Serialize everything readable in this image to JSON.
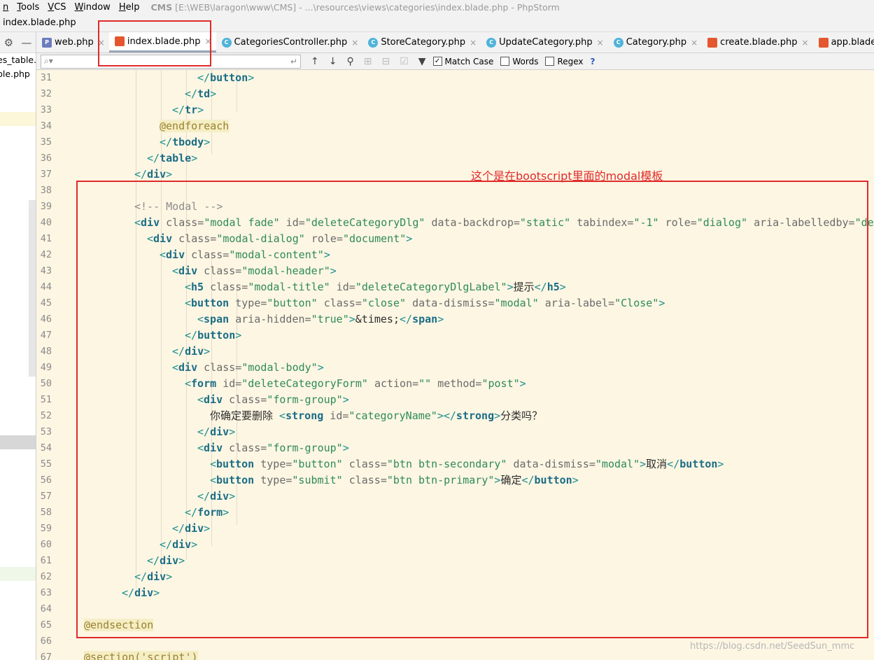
{
  "menubar": {
    "items": [
      "n",
      "Tools",
      "VCS",
      "Window",
      "Help"
    ],
    "title_app": "CMS",
    "title_path": "[E:\\WEB\\laragon\\www\\CMS] - ...\\resources\\views\\categories\\index.blade.php - PhpStorm"
  },
  "navbar": {
    "breadcrumb": "index.blade.php"
  },
  "left_panel": {
    "files": [
      "es_table.",
      "ble.php"
    ]
  },
  "tabs": [
    {
      "label": "web.php",
      "icon": "php-file-icon",
      "close": "×"
    },
    {
      "label": "index.blade.php",
      "icon": "blade-file-icon",
      "close": "×"
    },
    {
      "label": "CategoriesController.php",
      "icon": "class-file-icon",
      "close": "×"
    },
    {
      "label": "StoreCategory.php",
      "icon": "class-file-icon",
      "close": "×"
    },
    {
      "label": "UpdateCategory.php",
      "icon": "class-file-icon",
      "close": "×"
    },
    {
      "label": "Category.php",
      "icon": "class-file-icon",
      "close": "×"
    },
    {
      "label": "create.blade.php",
      "icon": "blade-file-icon",
      "close": "×"
    },
    {
      "label": "app.blade.php",
      "icon": "blade-file-icon",
      "close": "×"
    }
  ],
  "search": {
    "placeholder": "",
    "match_case_label": "Match Case",
    "match_case_checked": true,
    "words_label": "Words",
    "words_checked": false,
    "regex_label": "Regex",
    "regex_checked": false,
    "help_label": "?"
  },
  "line_numbers": [
    "31",
    "32",
    "33",
    "34",
    "35",
    "36",
    "37",
    "38",
    "39",
    "40",
    "41",
    "42",
    "43",
    "44",
    "45",
    "46",
    "47",
    "48",
    "49",
    "50",
    "51",
    "52",
    "53",
    "54",
    "55",
    "56",
    "57",
    "58",
    "59",
    "60",
    "61",
    "62",
    "63",
    "64",
    "65",
    "66",
    "67"
  ],
  "annotation_text": "这个是在bootscript里面的modal模板",
  "watermark": "https://blog.csdn.net/SeedSun_mmc",
  "colors": {
    "editor_bg": "#fdf6e3",
    "highlight_red": "#e02a2a",
    "tag_name": "#1a6d86",
    "attr_value": "#2e8b57"
  }
}
